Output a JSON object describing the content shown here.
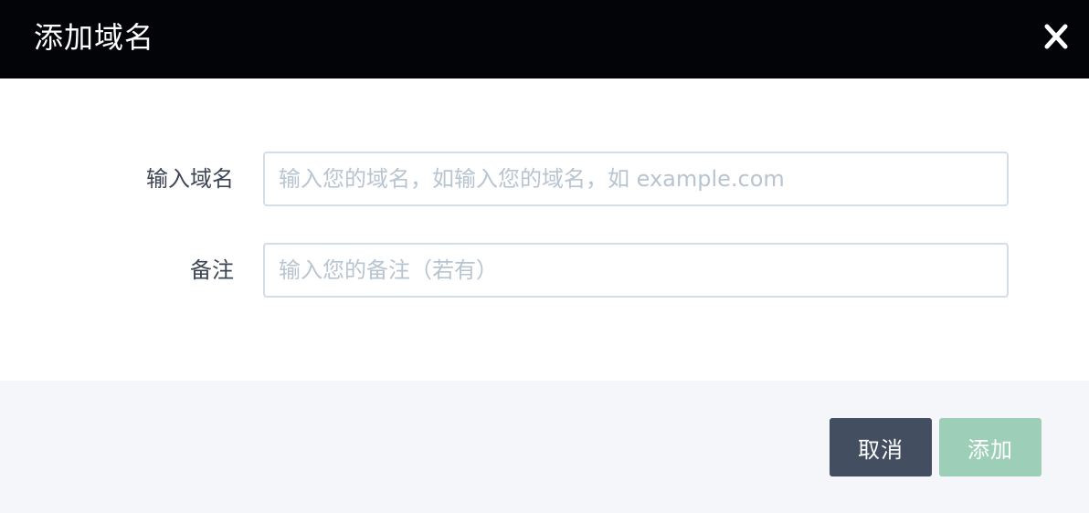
{
  "dialog": {
    "title": "添加域名",
    "close_icon": "close-icon"
  },
  "form": {
    "domain": {
      "label": "输入域名",
      "value": "",
      "placeholder": "输入您的域名，如输入您的域名，如 example.com"
    },
    "note": {
      "label": "备注",
      "value": "",
      "placeholder": "输入您的备注（若有）"
    }
  },
  "footer": {
    "cancel_label": "取消",
    "add_label": "添加"
  },
  "colors": {
    "header_bg": "#030407",
    "footer_bg": "#f4f6f9",
    "cancel_bg": "#434f60",
    "add_bg_disabled": "#9dcfb8",
    "input_border": "#d3dde6",
    "placeholder": "#b8c5d1",
    "label": "#3d4654"
  }
}
